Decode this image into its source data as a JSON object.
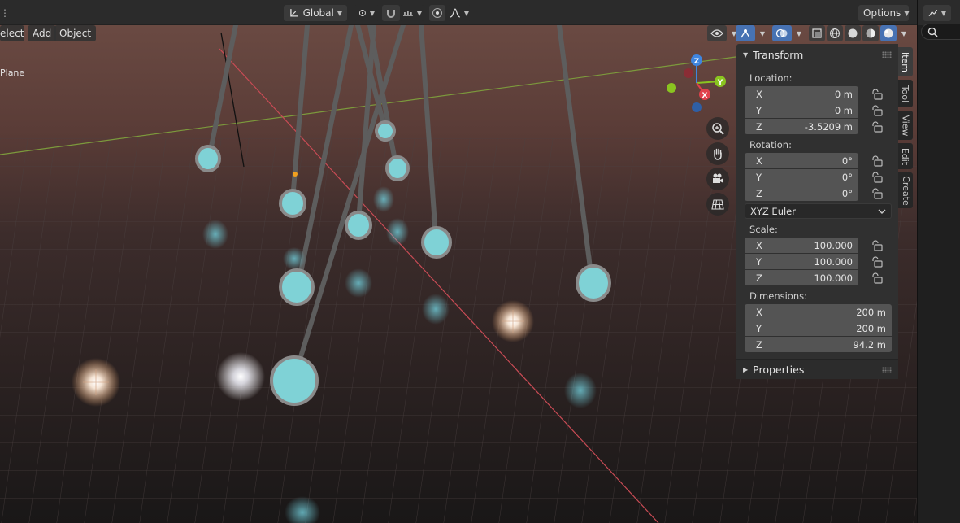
{
  "header": {
    "transform_orientation": "Global",
    "options_label": "Options"
  },
  "viewport_menu": {
    "select_label": "elect",
    "add_label": "Add",
    "object_label": "Object"
  },
  "active_object_label": "Plane",
  "gizmo": {
    "z": "Z",
    "y": "Y",
    "x": "X"
  },
  "panel": {
    "transform_title": "Transform",
    "location_label": "Location:",
    "location": [
      {
        "axis": "X",
        "value": "0 m"
      },
      {
        "axis": "Y",
        "value": "0 m"
      },
      {
        "axis": "Z",
        "value": "-3.5209 m"
      }
    ],
    "rotation_label": "Rotation:",
    "rotation": [
      {
        "axis": "X",
        "value": "0°"
      },
      {
        "axis": "Y",
        "value": "0°"
      },
      {
        "axis": "Z",
        "value": "0°"
      }
    ],
    "rotation_mode": "XYZ Euler",
    "scale_label": "Scale:",
    "scale": [
      {
        "axis": "X",
        "value": "100.000"
      },
      {
        "axis": "Y",
        "value": "100.000"
      },
      {
        "axis": "Z",
        "value": "100.000"
      }
    ],
    "dimensions_label": "Dimensions:",
    "dimensions": [
      {
        "axis": "X",
        "value": "200 m"
      },
      {
        "axis": "Y",
        "value": "200 m"
      },
      {
        "axis": "Z",
        "value": "94.2 m"
      }
    ],
    "properties_title": "Properties"
  },
  "tabs": [
    "Item",
    "Tool",
    "View",
    "Edit",
    "Create"
  ],
  "colors": {
    "accent": "#4772b3",
    "pendulum_disc": "#7fd2d6",
    "axis_x": "#e0414b",
    "axis_y": "#8ac420",
    "axis_z": "#3f85df"
  }
}
